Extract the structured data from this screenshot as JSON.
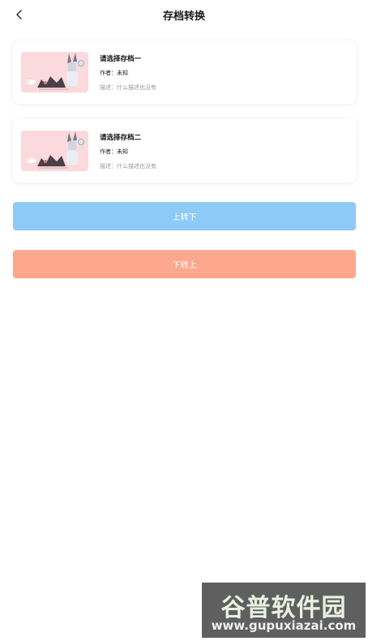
{
  "header": {
    "title": "存档转换",
    "back_icon": "chevron-left-icon"
  },
  "saves": [
    {
      "title": "请选择存档一",
      "author": "作者：未知",
      "description": "描述：什么描述也没有"
    },
    {
      "title": "请选择存档二",
      "author": "作者：未知",
      "description": "描述：什么描述也没有"
    }
  ],
  "actions": {
    "up_to_down": "上转下",
    "down_to_up": "下转上"
  },
  "colors": {
    "up_button": "#8ecaf8",
    "down_button": "#fda88e",
    "thumbnail_bg": "#fbd9dc"
  },
  "watermark": {
    "logo_text": "谷普软件园",
    "url": "www.gupuxiazai.com"
  }
}
